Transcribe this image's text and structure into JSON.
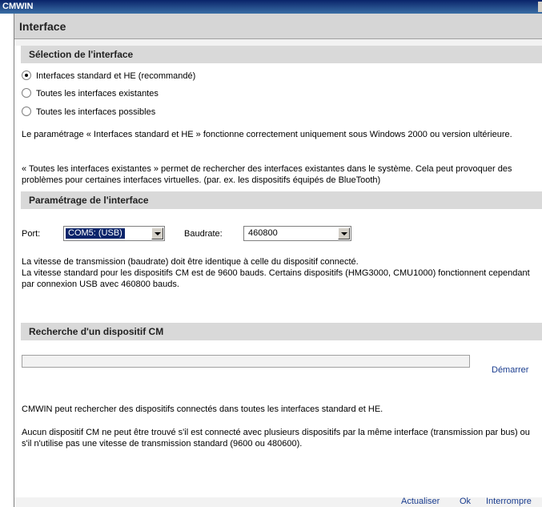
{
  "window": {
    "title": "CMWIN"
  },
  "header": {
    "title": "Interface"
  },
  "selection": {
    "heading": "Sélection de l'interface",
    "options": [
      {
        "label": "Interfaces standard et HE (recommandé)",
        "checked": true
      },
      {
        "label": "Toutes les interfaces existantes",
        "checked": false
      },
      {
        "label": "Toutes les interfaces possibles",
        "checked": false
      }
    ],
    "note1": "Le paramétrage « Interfaces standard et HE » fonctionne correctement uniquement sous Windows 2000 ou version ultérieure.",
    "note2": "« Toutes les interfaces existantes » permet de rechercher des interfaces existantes dans le système. Cela peut provoquer des problèmes pour certaines interfaces virtuelles. (par. ex. les dispositifs équipés de BlueTooth)"
  },
  "params": {
    "heading": "Paramétrage de l'interface",
    "port_label": "Port:",
    "port_value": "COM5: (USB)",
    "baud_label": "Baudrate:",
    "baud_value": "460800",
    "info1": "La vitesse de transmission (baudrate) doit être identique à celle du dispositif connecté.",
    "info2": "La vitesse standard pour les dispositifs CM est de 9600 bauds. Certains dispositifs (HMG3000, CMU1000) fonctionnent cependant par connexion USB avec 460800 bauds."
  },
  "search": {
    "heading": "Recherche d'un dispositif CM",
    "progress": 0,
    "start_label": "Démarrer",
    "info1": "CMWIN peut rechercher des dispositifs connectés dans toutes les interfaces standard et HE.",
    "info2": "Aucun dispositif CM ne peut être trouvé s'il est connecté avec plusieurs dispositifs par la même interface (transmission par bus) ou s'il n'utilise pas une vitesse de transmission standard (9600 ou 480600)."
  },
  "actions": {
    "refresh": "Actualiser",
    "ok": "Ok",
    "cancel": "Interrompre"
  }
}
